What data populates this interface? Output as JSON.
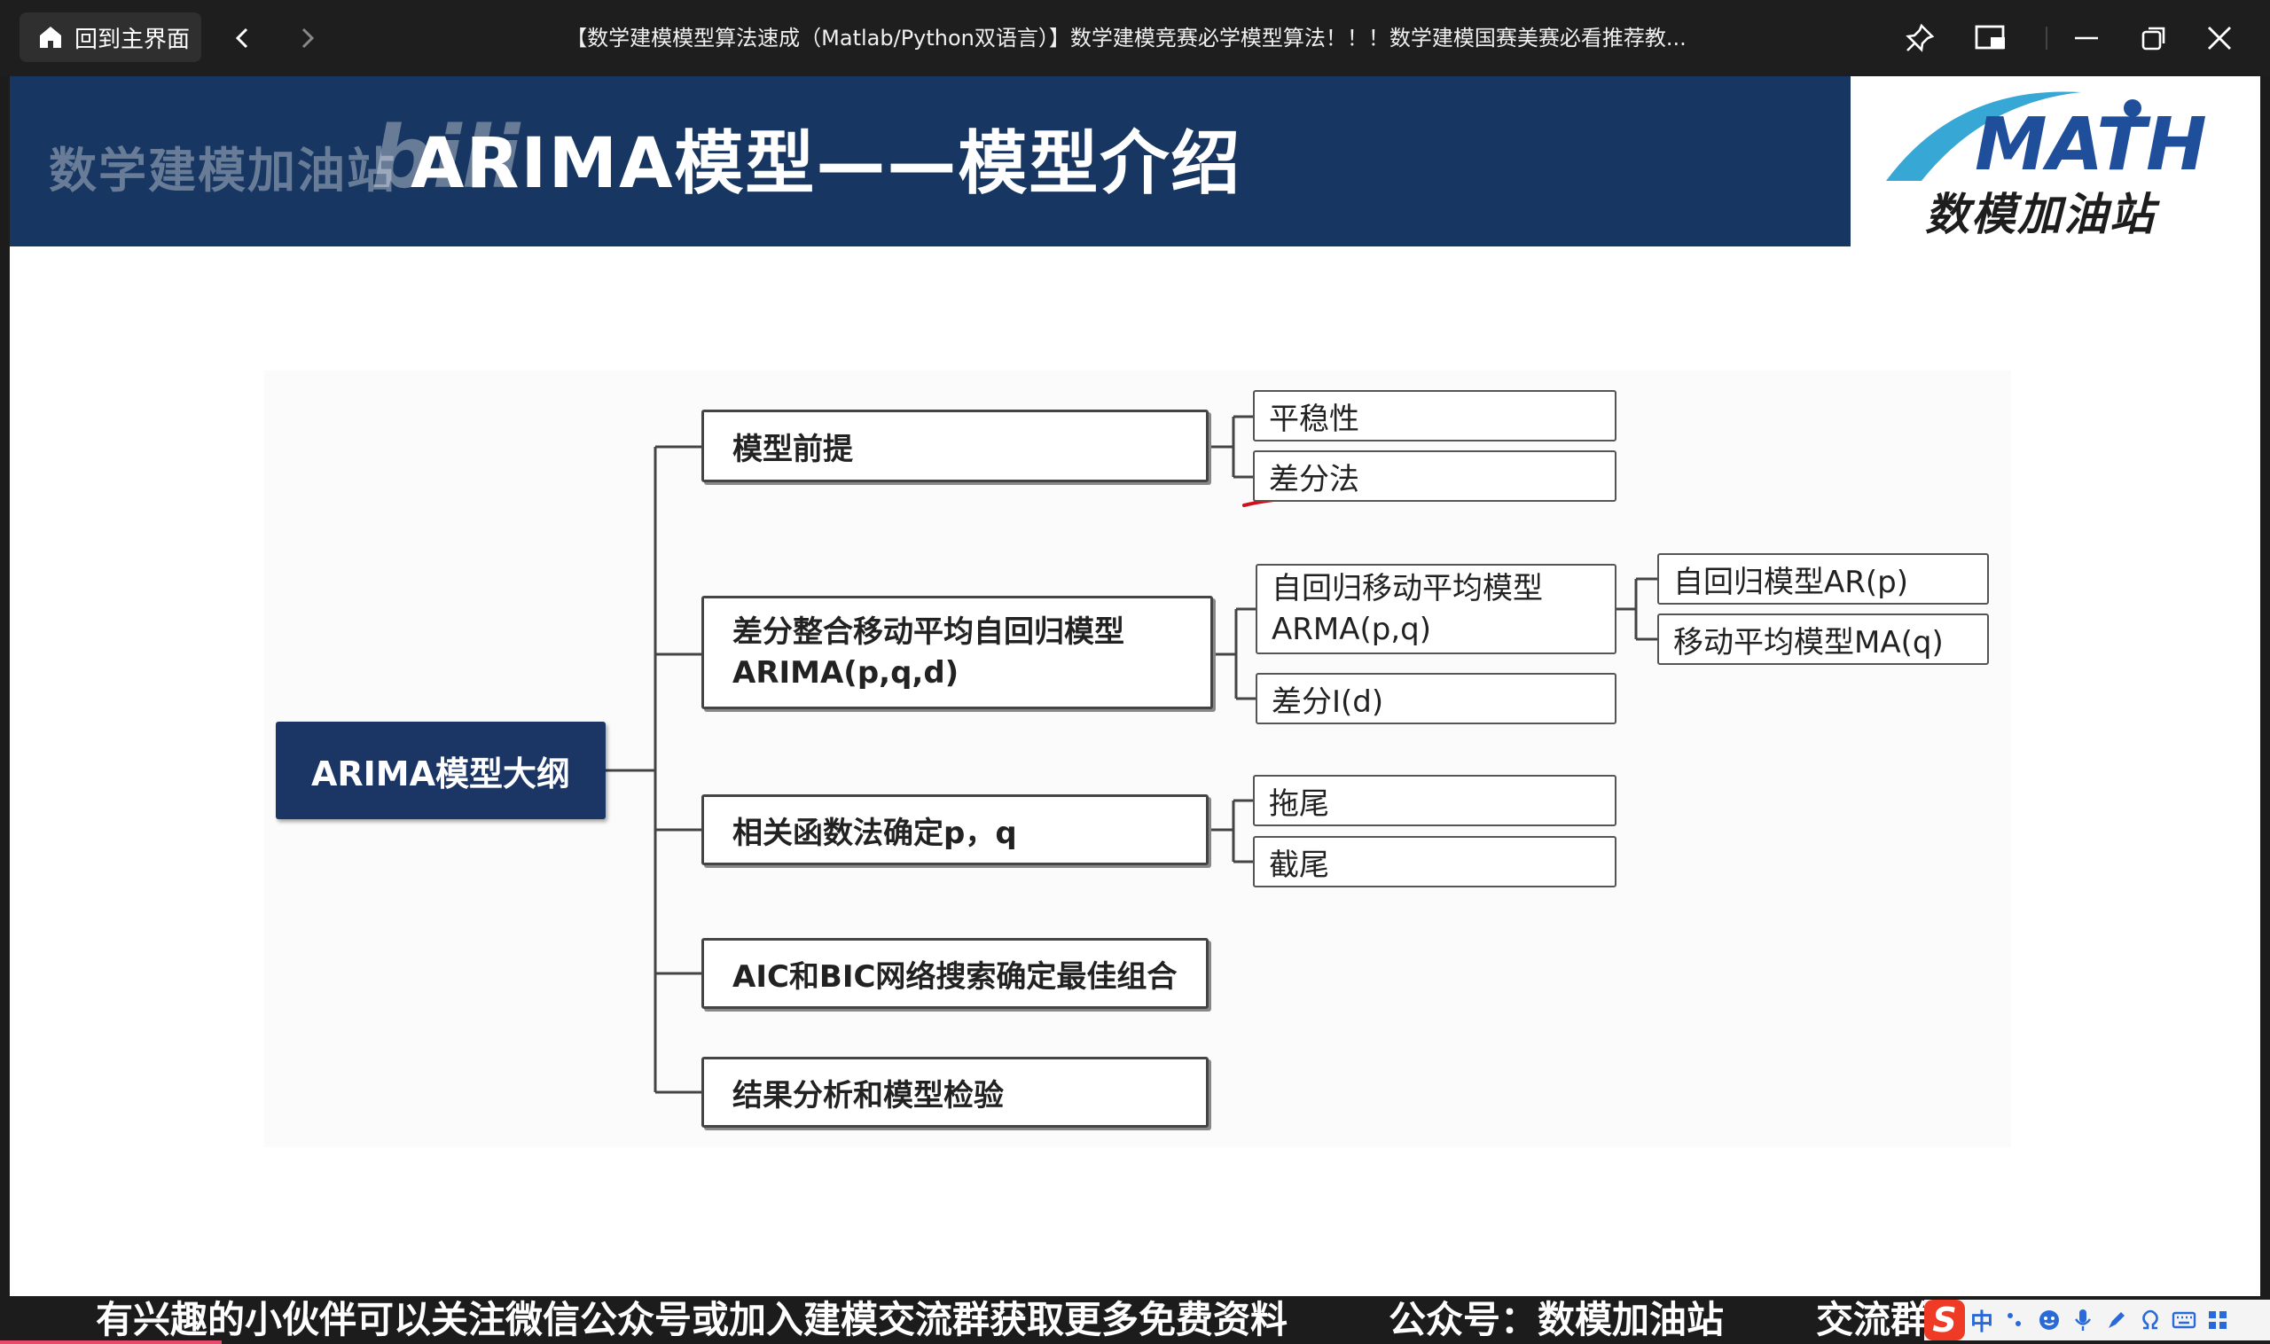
{
  "titlebar": {
    "home_label": "回到主界面",
    "window_title": "【数学建模模型算法速成（Matlab/Python双语言）】数学建模竞赛必学模型算法！！！数学建模国赛美赛必看推荐教..."
  },
  "slide": {
    "watermark_text": "数学建模加油站",
    "bilibili_watermark": "bili",
    "title": "ARIMA模型——模型介绍",
    "logo_text": "MATH",
    "logo_subtitle": "数模加油站"
  },
  "mindmap": {
    "root": "ARIMA模型大纲",
    "branches": [
      {
        "label": "模型前提",
        "children": [
          "平稳性",
          "差分法"
        ]
      },
      {
        "label_line1": "差分整合移动平均自回归模型",
        "label_line2": "ARIMA(p,q,d)",
        "children": [
          {
            "label_line1": "自回归移动平均模型",
            "label_line2": "ARMA(p,q)",
            "children": [
              "自回归模型AR(p)",
              "移动平均模型MA(q)"
            ]
          },
          {
            "label": "差分I(d)"
          }
        ]
      },
      {
        "label": "相关函数法确定p，q",
        "children": [
          "拖尾",
          "截尾"
        ]
      },
      {
        "label": "AIC和BIC网络搜索确定最佳组合"
      },
      {
        "label": "结果分析和模型检验"
      }
    ]
  },
  "bottombar": {
    "ticker_1": "有兴趣的小伙伴可以关注微信公众号或加入建模交流群获取更多免费资料",
    "ticker_2": "公众号：数模加油站",
    "ticker_3": "交流群",
    "ime_logo": "S",
    "ime_mode": "中"
  },
  "colors": {
    "banner": "#173661",
    "root_box": "#1b3564",
    "annotation": "#d0101a",
    "logo_blue": "#1f4e9b"
  }
}
